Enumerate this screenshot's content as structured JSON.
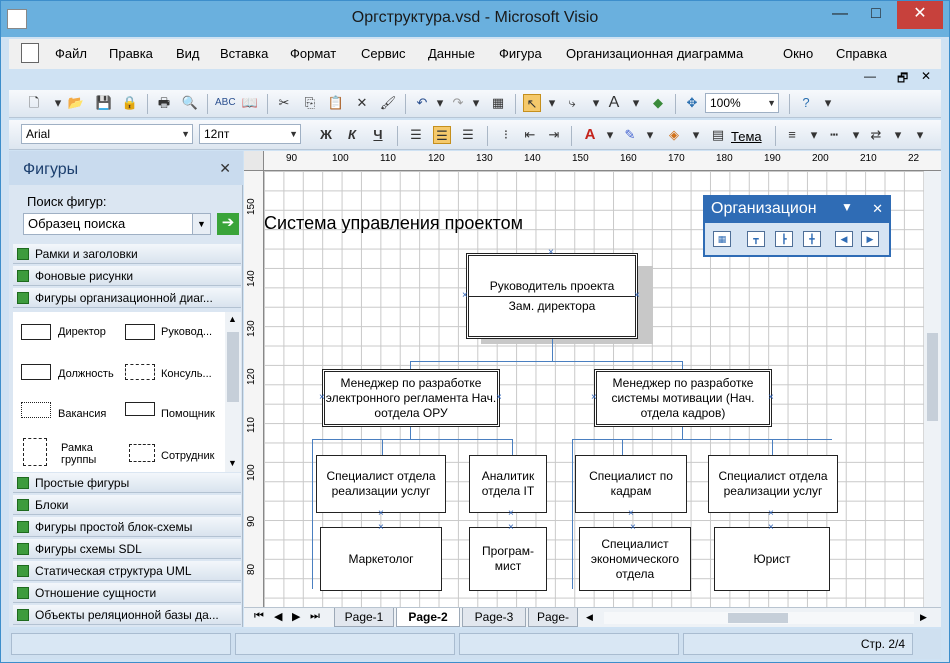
{
  "window": {
    "title": "Оргструктура.vsd - Microsoft Visio",
    "minimize_glyph": "—",
    "maximize_glyph": "□",
    "close_glyph": "✕"
  },
  "menu": {
    "items": [
      "Файл",
      "Правка",
      "Вид",
      "Вставка",
      "Формат",
      "Сервис",
      "Данные",
      "Фигура",
      "Организационная диаграмма",
      "Окно",
      "Справка"
    ],
    "doc_controls": [
      "✕",
      "🗗",
      "—"
    ]
  },
  "toolbar_standard": {
    "zoom": "100%"
  },
  "toolbar_format": {
    "font": "Arial",
    "size": "12пт",
    "bold": "Ж",
    "italic": "К",
    "underline": "Ч",
    "theme": "Тема"
  },
  "shapes_panel": {
    "title": "Фигуры",
    "search_label": "Поиск фигур:",
    "search_placeholder": "Образец поиска",
    "stencils_top": [
      "Рамки и заголовки",
      "Фоновые рисунки",
      "Фигуры организационной диаг..."
    ],
    "shapes": [
      {
        "label": "Директор"
      },
      {
        "label": "Руковод..."
      },
      {
        "label": "Должность"
      },
      {
        "label": "Консуль..."
      },
      {
        "label": "Вакансия"
      },
      {
        "label": "Помощник"
      },
      {
        "label": "Рамка группы"
      },
      {
        "label": "Сотрудник"
      }
    ],
    "stencils_bottom": [
      "Простые фигуры",
      "Блоки",
      "Фигуры простой блок-схемы",
      "Фигуры схемы SDL",
      "Статическая структура UML",
      "Отношение сущности",
      "Объекты реляционной базы да..."
    ]
  },
  "ruler": {
    "h_ticks": [
      "90",
      "100",
      "110",
      "120",
      "130",
      "140",
      "150",
      "160",
      "170",
      "180",
      "190",
      "200",
      "210",
      "22"
    ],
    "v_ticks": [
      "150",
      "140",
      "130",
      "120",
      "110",
      "100",
      "90",
      "80"
    ]
  },
  "diagram": {
    "title": "Система управления проектом",
    "root": {
      "line1": "Руководитель проекта",
      "line2": "Зам. директора"
    },
    "managers": [
      {
        "text": "Менеджер по разработке электронного регламента Нач. оотдела ОРУ"
      },
      {
        "text": "Менеджер по разработке системы мотивации (Нач. отдела кадров)"
      }
    ],
    "staff_row1": [
      "Специалист отдела реализации услуг",
      "Аналитик отдела IT",
      "Специалист по кадрам",
      "Специалист отдела реализации услуг"
    ],
    "staff_row2": [
      "Маркетолог",
      "Програм-мист",
      "Специалист экономического отдела",
      "Юрист"
    ]
  },
  "org_toolbar": {
    "title": "Организацион"
  },
  "pages": {
    "tabs": [
      "Page-1",
      "Page-2",
      "Page-3",
      "Page-"
    ],
    "active": "Page-2"
  },
  "status": {
    "page": "Стр. 2/4"
  }
}
